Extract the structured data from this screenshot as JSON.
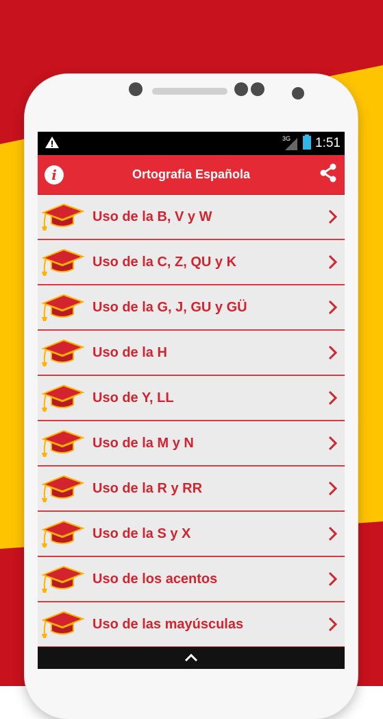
{
  "colors": {
    "background_red": "#c8121e",
    "background_yellow": "#ffc400",
    "app_bar": "#e32a35",
    "item_text": "#d2232f",
    "divider": "#d63a45"
  },
  "status_bar": {
    "warning_icon": "warning-icon",
    "network_label": "3G",
    "time": "1:51"
  },
  "app_bar": {
    "title": "Ortografia Española",
    "info_icon": "info-icon",
    "share_icon": "share-icon"
  },
  "items": [
    {
      "label": "Uso de la B, V y W"
    },
    {
      "label": "Uso de la C, Z, QU y K"
    },
    {
      "label": "Uso de la G, J, GU y GÜ"
    },
    {
      "label": "Uso de la H"
    },
    {
      "label": "Uso de Y, LL"
    },
    {
      "label": "Uso de la M y N"
    },
    {
      "label": "Uso de la R y RR"
    },
    {
      "label": "Uso de la S y X"
    },
    {
      "label": "Uso de los acentos"
    },
    {
      "label": "Uso de las mayúsculas"
    }
  ],
  "bottom_bar": {
    "icon": "chevron-up-icon"
  }
}
